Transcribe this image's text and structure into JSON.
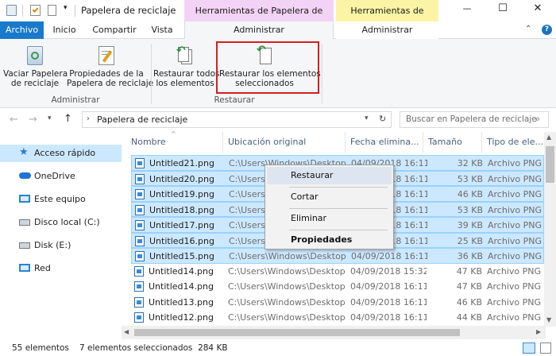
{
  "window": {
    "title": "Papelera de reciclaje",
    "minimize": "—",
    "maximize": "☐",
    "close": "✕"
  },
  "context_tabs": {
    "recycle_tools": "Herramientas de Papelera de reciclaje",
    "image_tools": "Herramientas de imagen"
  },
  "ribbon_tabs": {
    "archivo": "Archivo",
    "inicio": "Inicio",
    "compartir": "Compartir",
    "vista": "Vista",
    "administrar1": "Administrar",
    "administrar2": "Administrar"
  },
  "ribbon": {
    "empty_line1": "Vaciar Papelera",
    "empty_line2": "de reciclaje",
    "props_line1": "Propiedades de la",
    "props_line2": "Papelera de reciclaje",
    "restore_all_line1": "Restaurar todos",
    "restore_all_line2": "los elementos",
    "restore_sel_line1": "Restaurar los elementos",
    "restore_sel_line2": "seleccionados",
    "group_admin": "Administrar",
    "group_restore": "Restaurar"
  },
  "address": {
    "path": "Papelera de reciclaje",
    "search_placeholder": "Buscar en Papelera de reciclaje"
  },
  "nav": {
    "items": [
      "Acceso rápido",
      "OneDrive",
      "Este equipo",
      "Disco local (C:)",
      "Disk (E:)",
      "Red"
    ]
  },
  "columns": {
    "name": "Nombre",
    "location": "Ubicación original",
    "date": "Fecha elimina...",
    "size": "Tamaño",
    "type": "Tipo de ele..."
  },
  "files": [
    {
      "name": "Untitled21.png",
      "loc": "C:\\Users\\Windows\\Desktop",
      "date": "04/09/2018 16:11",
      "size": "32 KB",
      "type": "Archivo PNG",
      "selected": true
    },
    {
      "name": "Untitled20.png",
      "loc": "C:\\Users\\Windows\\Desktop",
      "date": "04/09/2018 16:11",
      "size": "53 KB",
      "type": "Archivo PNG",
      "selected": true
    },
    {
      "name": "Untitled19.png",
      "loc": "C:\\Users\\Windows\\Desktop",
      "date": "04/09/2018 16:11",
      "size": "46 KB",
      "type": "Archivo PNG",
      "selected": true
    },
    {
      "name": "Untitled18.png",
      "loc": "C:\\Users\\Windows\\Desktop",
      "date": "04/09/2018 16:11",
      "size": "53 KB",
      "type": "Archivo PNG",
      "selected": true
    },
    {
      "name": "Untitled17.png",
      "loc": "C:\\Users\\Windows\\Desktop",
      "date": "04/09/2018 16:11",
      "size": "39 KB",
      "type": "Archivo PNG",
      "selected": true
    },
    {
      "name": "Untitled16.png",
      "loc": "C:\\Users\\Windows\\Desktop",
      "date": "04/09/2018 16:11",
      "size": "25 KB",
      "type": "Archivo PNG",
      "selected": true
    },
    {
      "name": "Untitled15.png",
      "loc": "C:\\Users\\Windows\\Desktop",
      "date": "04/09/2018 16:11",
      "size": "36 KB",
      "type": "Archivo PNG",
      "selected": true
    },
    {
      "name": "Untitled14.png",
      "loc": "C:\\Users\\Windows\\Desktop",
      "date": "04/09/2018 15:32",
      "size": "47 KB",
      "type": "Archivo PNG",
      "selected": false
    },
    {
      "name": "Untitled14.png",
      "loc": "C:\\Users\\Windows\\Desktop",
      "date": "04/09/2018 16:11",
      "size": "47 KB",
      "type": "Archivo PNG",
      "selected": false
    },
    {
      "name": "Untitled13.png",
      "loc": "C:\\Users\\Windows\\Desktop",
      "date": "04/09/2018 16:11",
      "size": "46 KB",
      "type": "Archivo PNG",
      "selected": false
    },
    {
      "name": "Untitled12.png",
      "loc": "C:\\Users\\Windows\\Desktop",
      "date": "04/09/2018 16:11",
      "size": "44 KB",
      "type": "Archivo PNG",
      "selected": false
    }
  ],
  "context_menu": {
    "restore": "Restaurar",
    "cut": "Cortar",
    "delete": "Eliminar",
    "properties": "Propiedades"
  },
  "status": {
    "count": "55 elementos",
    "selected": "7 elementos seleccionados  284 KB"
  },
  "colors": {
    "archivo_tab": "#1979ca",
    "recycle_context": "#f3d3f5",
    "image_context": "#fbf4a4",
    "highlight_box": "#d32020",
    "selection": "#cce8ff"
  }
}
